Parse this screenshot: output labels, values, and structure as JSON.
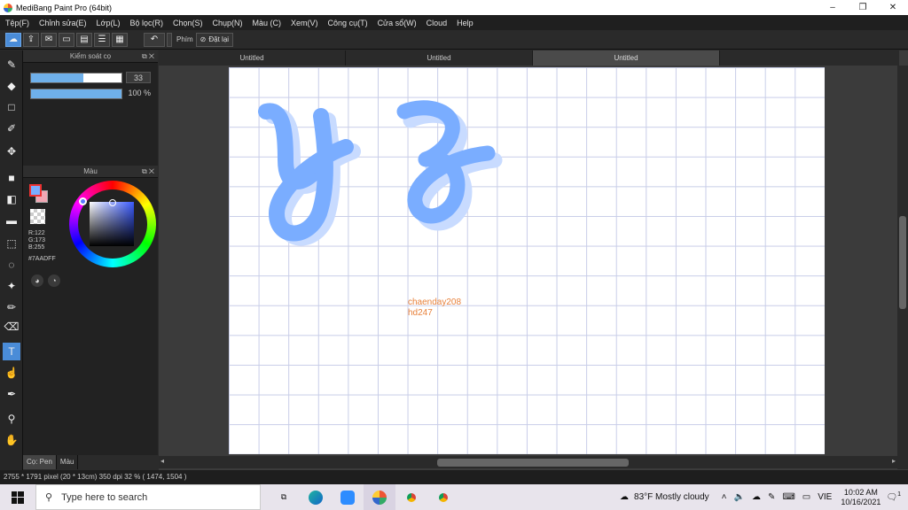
{
  "window": {
    "title": "MediBang Paint Pro (64bit)",
    "minimize": "–",
    "maximize": "❐",
    "close": "✕"
  },
  "menu": [
    "Tệp(F)",
    "Chỉnh sửa(E)",
    "Lớp(L)",
    "Bộ lọc(R)",
    "Chọn(S)",
    "Chụp(N)",
    "Màu (C)",
    "Xem(V)",
    "Công cụ(T)",
    "Cửa sổ(W)",
    "Cloud",
    "Help"
  ],
  "toolbar": {
    "undo_icon": "↶",
    "shortcut_label": "Phím",
    "reset_label": "Đặt lại"
  },
  "brush_panel": {
    "title": "Kiểm soát cọ",
    "size_value": "33",
    "size_fraction": 0.58,
    "opacity_value": "100 %",
    "opacity_fraction": 1.0
  },
  "color_panel": {
    "title": "Màu",
    "r": "R:122",
    "g": "G:173",
    "b": "B:255",
    "hex": "#7AADFF",
    "primary_color": "#7AADFF",
    "secondary_color": "#f2a7b4"
  },
  "tabs": [
    "Untitled",
    "Untitled",
    "Untitled"
  ],
  "canvas": {
    "watermark_line1": "chaenday208",
    "watermark_line2": "hd247",
    "letter_color": "#7AADFF",
    "shadow_color": "#c8dbff"
  },
  "bottom_tabs": [
    "Cọ: Pen",
    "Màu"
  ],
  "status": "2755 * 1791 pixel   (20 * 13cm)   350 dpi   32 %   ( 1474, 1504 )",
  "taskbar": {
    "search_placeholder": "Type here to search",
    "weather": "83°F  Mostly cloudy",
    "lang": "VIE",
    "time": "10:02 AM",
    "date": "10/16/2021",
    "notif_count": "1"
  }
}
